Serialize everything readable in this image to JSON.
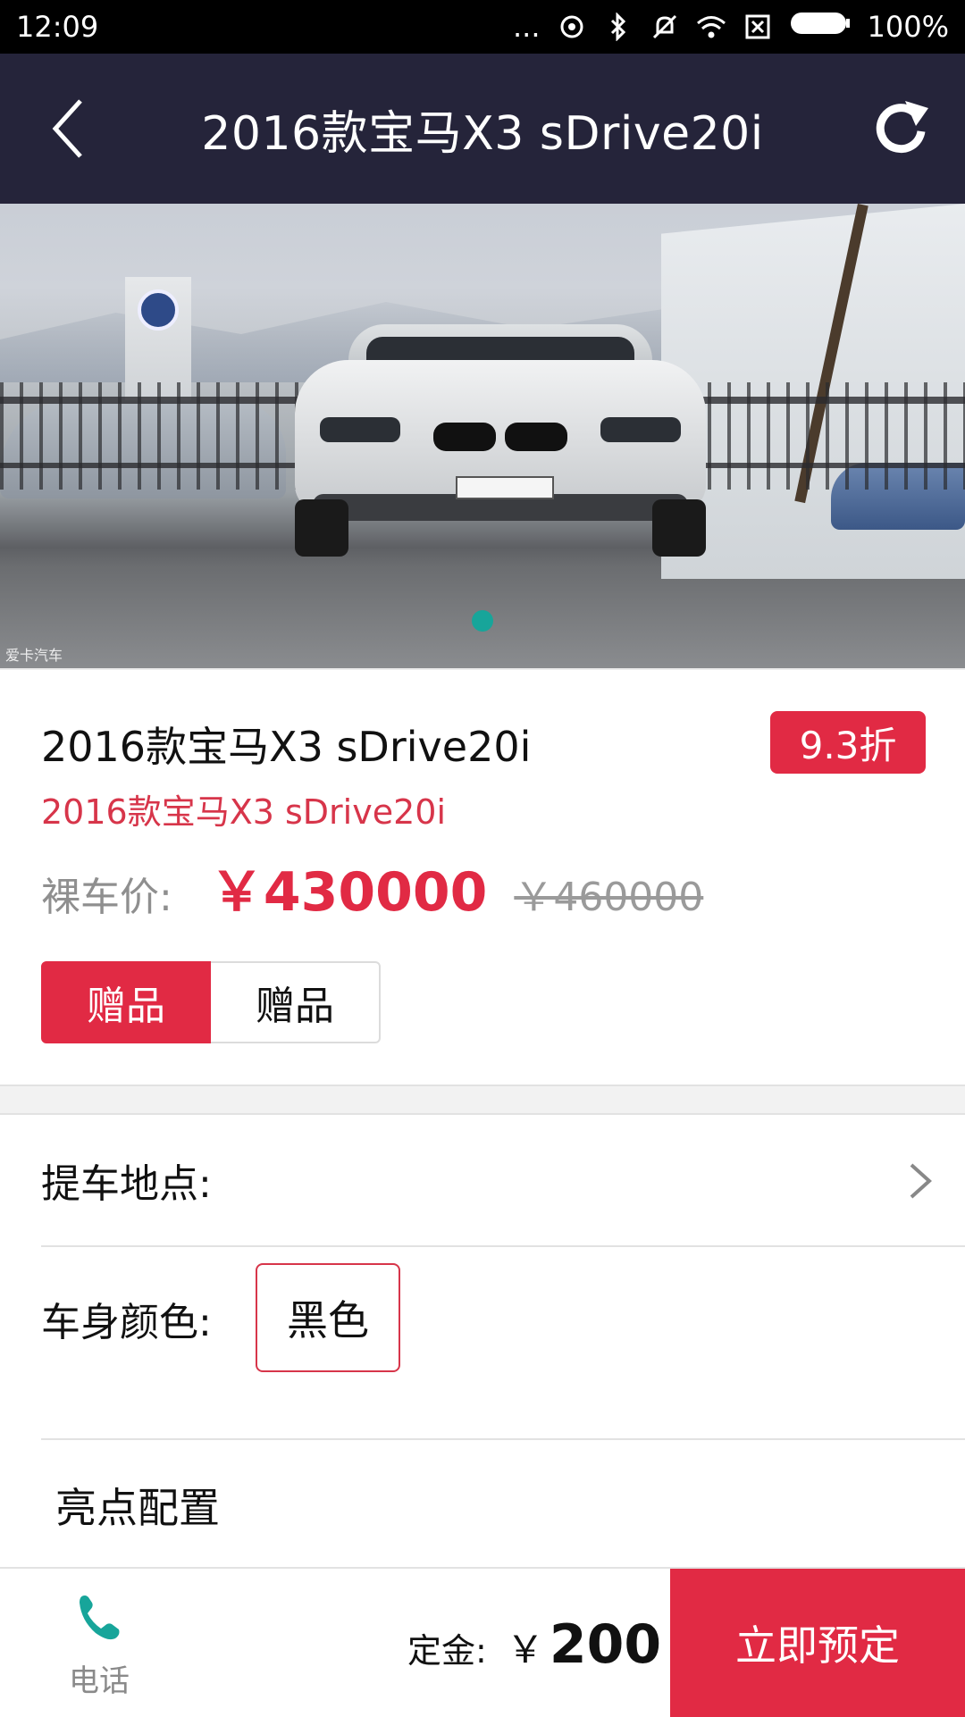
{
  "status_bar": {
    "time": "12:09",
    "dots": "...",
    "battery_percent": "100%"
  },
  "nav": {
    "title": "2016款宝马X3 sDrive20i",
    "back_icon": "chevron-left-icon",
    "refresh_icon": "refresh-icon"
  },
  "hero": {
    "watermark": "爱卡汽车",
    "plate_text": "爱卡汽车",
    "current_slide": 1,
    "total_slides": 1
  },
  "product": {
    "title": "2016款宝马X3 sDrive20i",
    "subtitle": "2016款宝马X3 sDrive20i",
    "discount": "9.3折",
    "price_label": "裸车价:",
    "price_now": "￥430000",
    "price_old": "￥460000",
    "gift_tabs": [
      "赠品",
      "赠品"
    ]
  },
  "options": {
    "pickup_label": "提车地点:",
    "color_label": "车身颜色:",
    "color_value": "黑色",
    "highlight_label": "亮点配置"
  },
  "bottom_bar": {
    "phone_label": "电话",
    "deposit_label": "定金:",
    "deposit_currency": "￥",
    "deposit_value": "200",
    "book_label": "立即预定"
  },
  "colors": {
    "nav_bg": "#25243a",
    "accent_red": "#e12a44",
    "subtitle_red": "#d7354a",
    "pager_teal": "#17a59a",
    "phone_teal": "#17a59a"
  }
}
